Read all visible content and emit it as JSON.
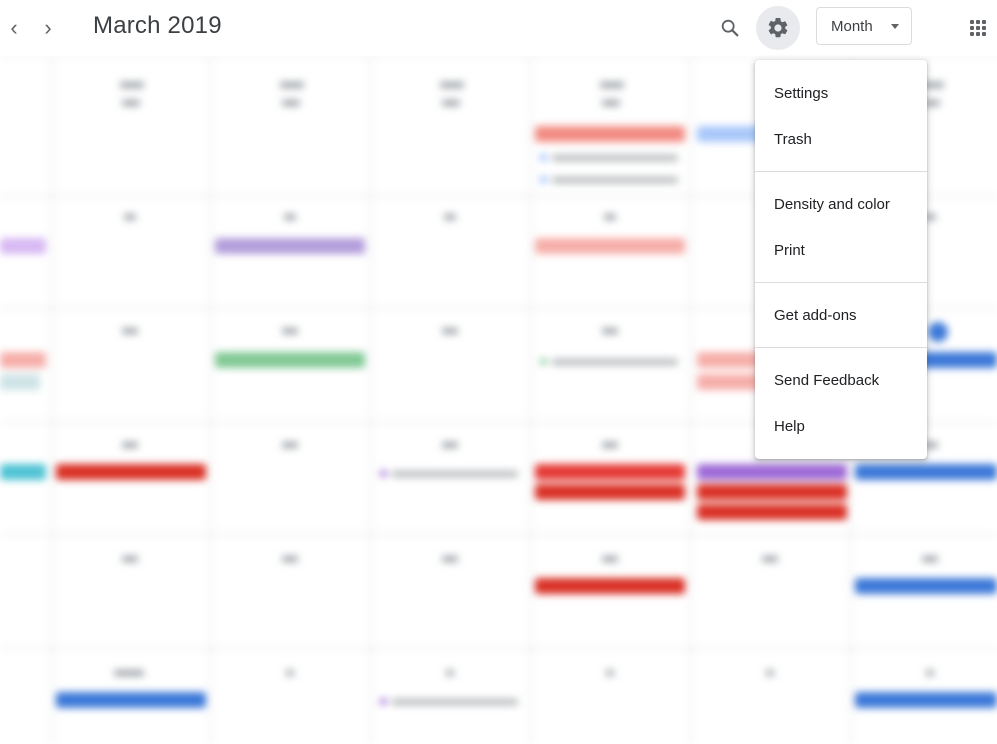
{
  "header": {
    "prev_glyph": "‹",
    "next_glyph": "›",
    "title": "March 2019",
    "view_label": "Month",
    "icons": [
      "chevron-left-icon",
      "chevron-right-icon",
      "search-icon",
      "gear-icon",
      "chevron-down-icon",
      "apps-grid-icon"
    ]
  },
  "settings_menu": {
    "groups": [
      [
        "Settings",
        "Trash"
      ],
      [
        "Density and color",
        "Print"
      ],
      [
        "Get add-ons"
      ],
      [
        "Send Feedback",
        "Help"
      ]
    ]
  },
  "colors": {
    "text": "#3c4043",
    "icon": "#5f6368",
    "divider": "#dadce0",
    "gear_highlight": "#e8eaed",
    "event_red": "#d93025",
    "event_blue": "#3b78d8",
    "event_purple": "#9e69d6",
    "event_green": "#33b679",
    "event_pink": "#f28b82",
    "event_teal": "#4fc3d4"
  }
}
